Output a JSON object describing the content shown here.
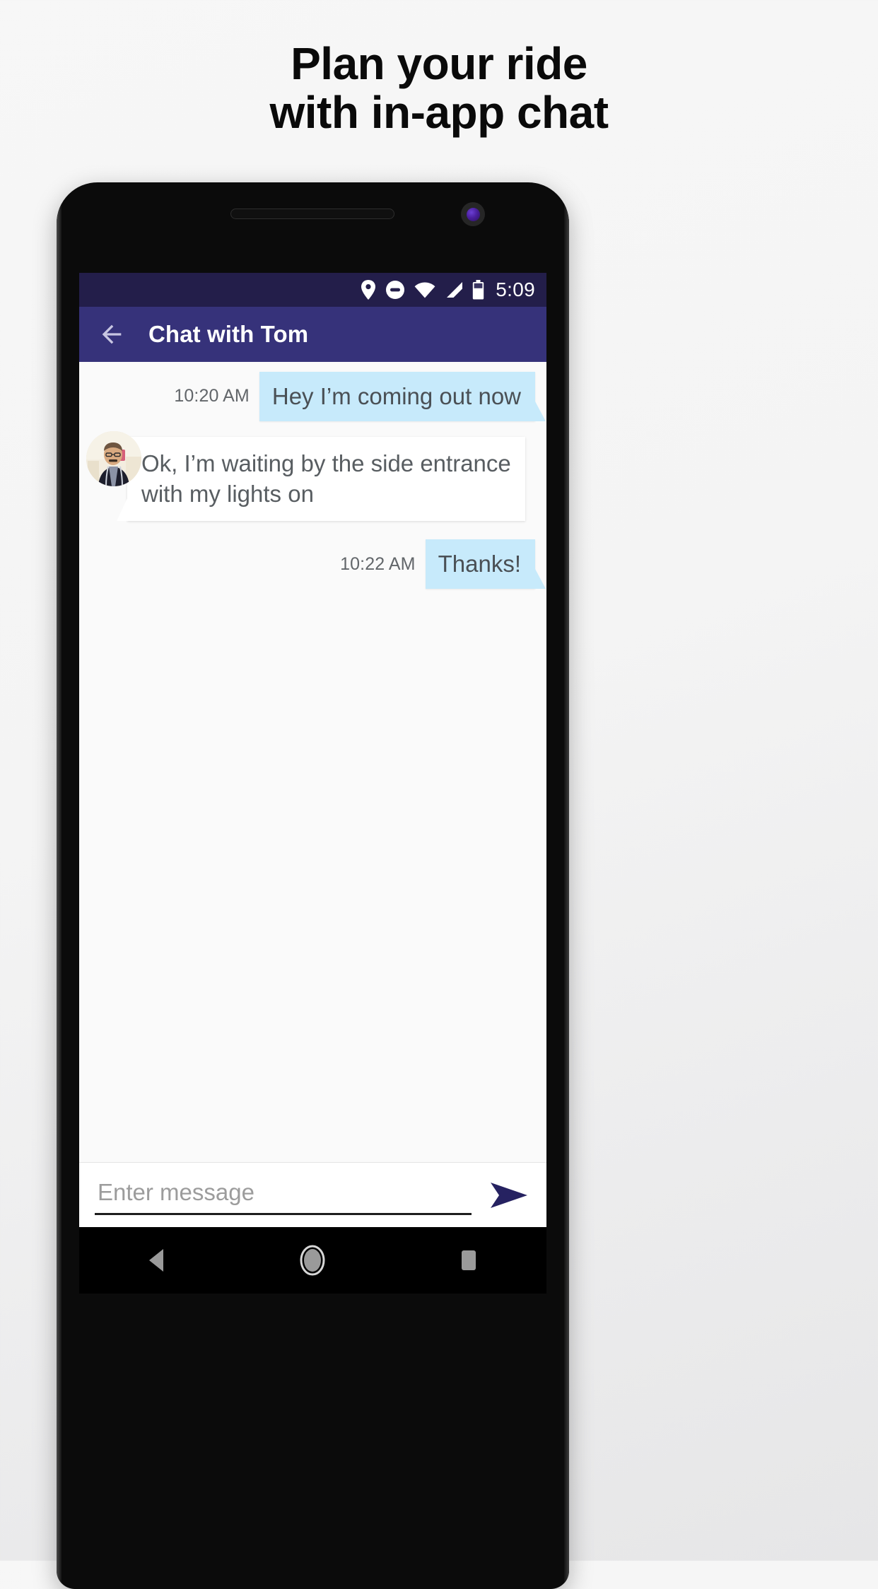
{
  "promo": {
    "heading_line1": "Plan your ride",
    "heading_line2": "with in-app chat"
  },
  "device": {
    "speaker_icon": "speaker-grille",
    "camera_icon": "front-camera-lens"
  },
  "status_bar": {
    "time": "5:09",
    "icons": [
      "location-pin-icon",
      "do-not-disturb-icon",
      "wifi-icon",
      "cell-signal-icon",
      "battery-icon"
    ],
    "background_color": "#231e4a"
  },
  "app_bar": {
    "back_icon": "back-arrow-icon",
    "title": "Chat with Tom",
    "background_color": "#36327a"
  },
  "conversation": {
    "messages": [
      {
        "direction": "outgoing",
        "time": "10:20 AM",
        "text": "Hey I’m coming out now",
        "bubble_color": "#c7eafb"
      },
      {
        "direction": "incoming",
        "time": "",
        "text": "Ok, I’m waiting by the side entrance with my lights on",
        "bubble_color": "#ffffff",
        "avatar": "contact-avatar"
      },
      {
        "direction": "outgoing",
        "time": "10:22 AM",
        "text": "Thanks!",
        "bubble_color": "#c7eafb"
      }
    ]
  },
  "composer": {
    "placeholder": "Enter message",
    "value": "",
    "send_icon": "send-arrow-icon",
    "send_color": "#262261"
  },
  "nav_bar": {
    "back_icon": "android-back-icon",
    "home_icon": "android-home-icon",
    "recents_icon": "android-recents-icon"
  }
}
